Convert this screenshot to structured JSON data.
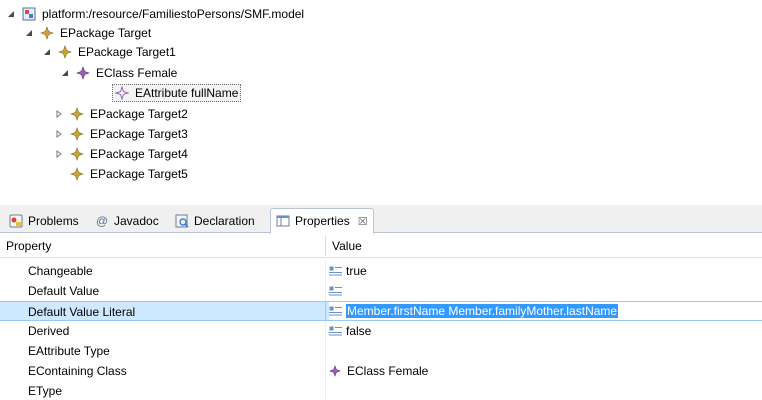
{
  "tree": {
    "root": "platform:/resource/FamiliestoPersons/SMF.model",
    "epackage_target": "EPackage Target",
    "epackage_target1": "EPackage Target1",
    "eclass_female": "EClass Female",
    "eattribute_fullname": "EAttribute fullName",
    "epackage_target2": "EPackage Target2",
    "epackage_target3": "EPackage Target3",
    "epackage_target4": "EPackage Target4",
    "epackage_target5": "EPackage Target5"
  },
  "tabs": {
    "problems": "Problems",
    "javadoc": "Javadoc",
    "declaration": "Declaration",
    "properties": "Properties",
    "close_glyph": "☒"
  },
  "properties": {
    "header_property": "Property",
    "header_value": "Value",
    "rows": [
      {
        "name": "Changeable",
        "value": "true"
      },
      {
        "name": "Default Value",
        "value": ""
      },
      {
        "name": "Default Value Literal",
        "value": "Member.firstName Member.familyMother.lastName"
      },
      {
        "name": "Derived",
        "value": "false"
      },
      {
        "name": "EAttribute Type",
        "value": ""
      },
      {
        "name": "EContaining Class",
        "value": "EClass Female"
      },
      {
        "name": "EType",
        "value": ""
      }
    ]
  },
  "colors": {
    "epackage_icon": "#c8a53a",
    "eclass_icon": "#9a5fb8",
    "selection_bg": "#cde8ff",
    "edit_selection": "#3399ff"
  }
}
